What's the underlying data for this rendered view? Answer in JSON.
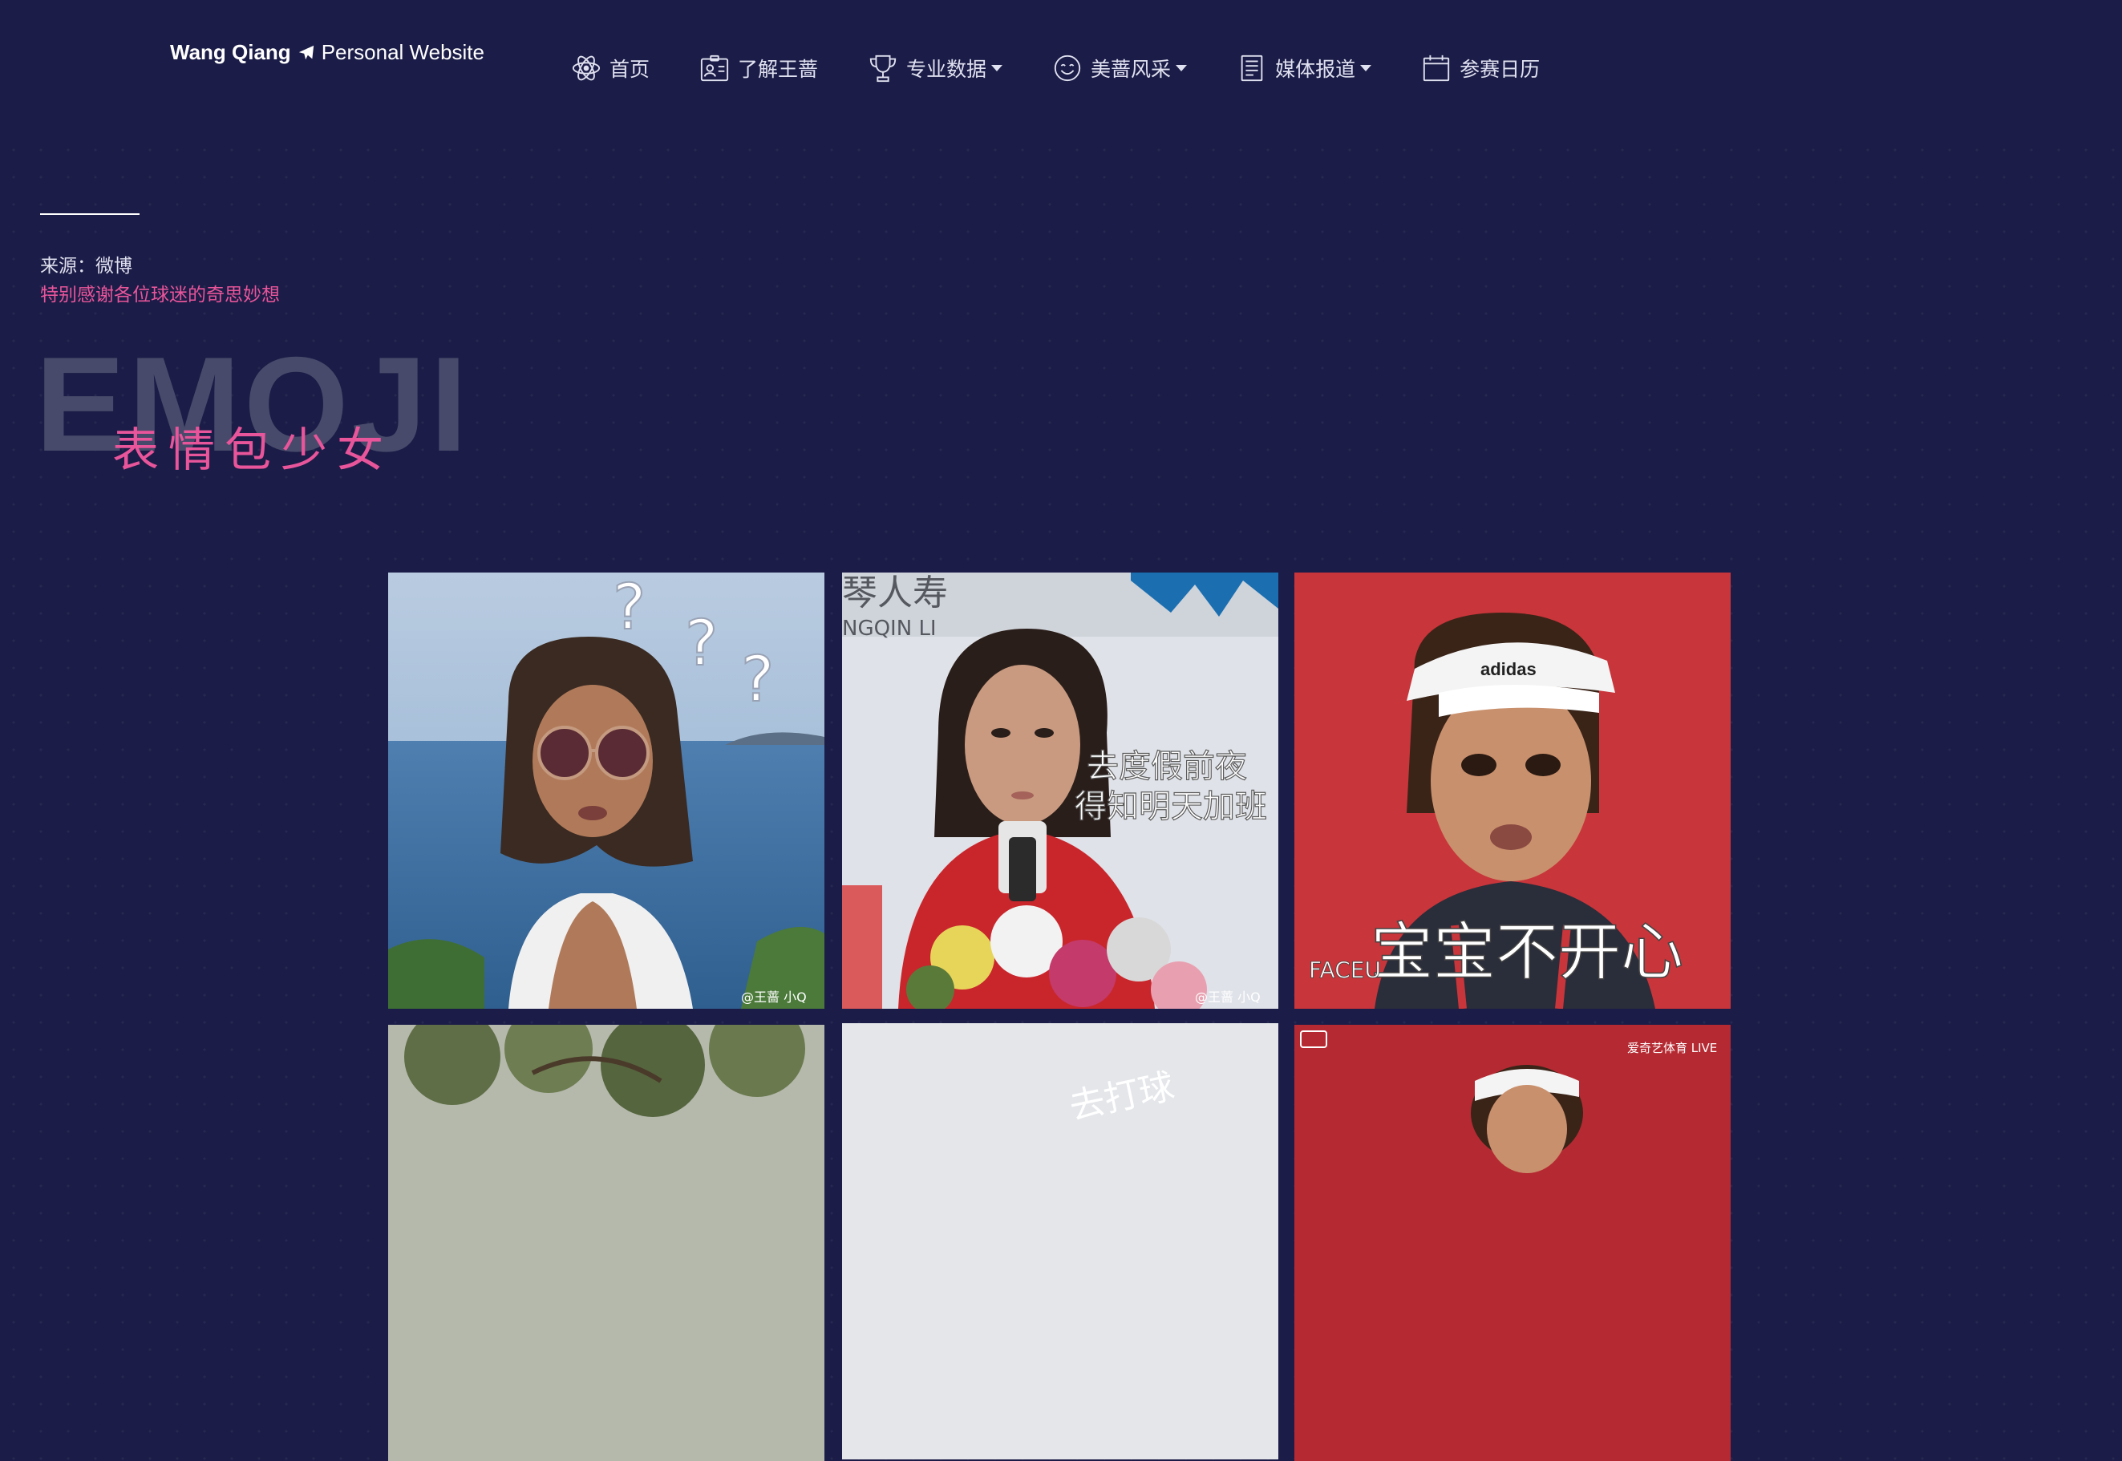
{
  "brand": {
    "name": "Wang Qiang",
    "tagline": "Personal Website"
  },
  "nav": {
    "items": [
      {
        "label": "首页",
        "icon": "atom-icon"
      },
      {
        "label": "了解王蔷",
        "icon": "id-card-icon"
      },
      {
        "label": "专业数据",
        "icon": "trophy-icon"
      },
      {
        "label": "美蔷风采",
        "icon": "smiley-icon"
      },
      {
        "label": "媒体报道",
        "icon": "document-icon"
      },
      {
        "label": "参赛日历",
        "icon": "calendar-icon"
      }
    ]
  },
  "section": {
    "source": "来源：微博",
    "thanks": "特别感谢各位球迷的奇思妙想",
    "bg_title": "EMOJI",
    "title": "表情包少女"
  },
  "gallery": {
    "photos": [
      {
        "caption": "",
        "watermark": "@王蔷 小Q",
        "marks": "? ? ?"
      },
      {
        "caption": "去度假前夜\n得知明天加班",
        "watermark": "@王蔷 小Q",
        "banner": "琴人寿",
        "banner2": "NGQIN LI"
      },
      {
        "caption": "宝宝不开心",
        "watermark": "",
        "brand": "FACEU"
      },
      {
        "caption": "",
        "watermark": ""
      },
      {
        "caption": "去打球",
        "watermark": ""
      },
      {
        "caption": "",
        "watermark": "爱奇艺体育 LIVE"
      }
    ]
  },
  "colors": {
    "background": "#1b1c47",
    "accent": "#e8559a",
    "text": "#ffffff"
  }
}
